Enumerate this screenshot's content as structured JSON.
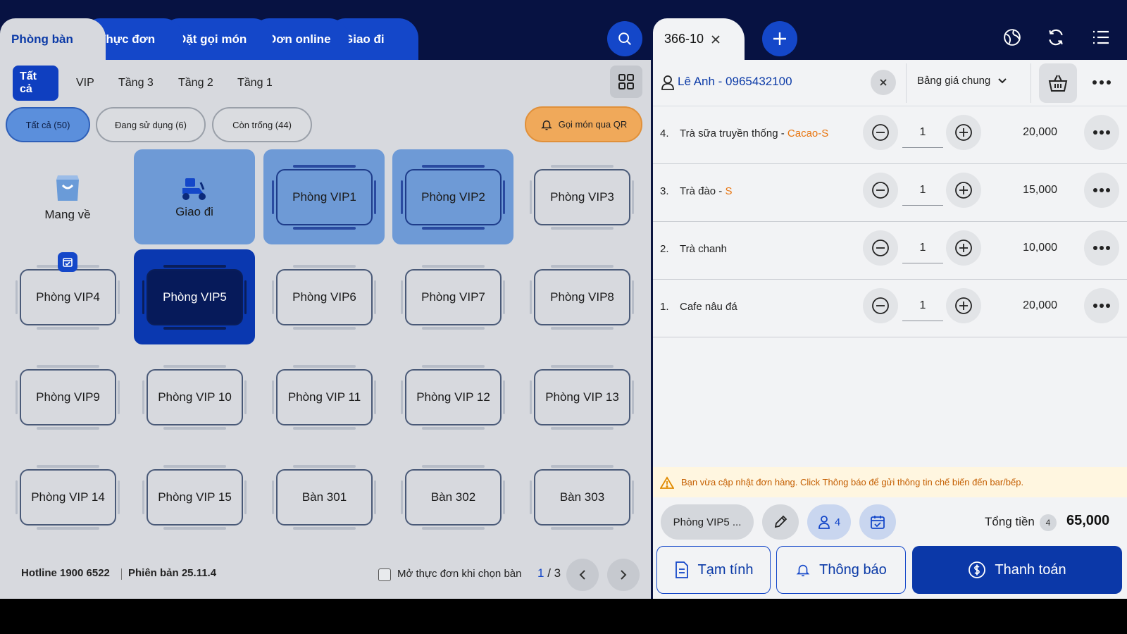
{
  "top_tabs": [
    {
      "label": "Phòng bàn"
    },
    {
      "label": "Thực đơn"
    },
    {
      "label": "Đặt gọi món"
    },
    {
      "label": "Đơn online"
    },
    {
      "label": "Giao đi"
    }
  ],
  "order_tab": {
    "label": "366-10"
  },
  "floors": [
    "Tất cả",
    "VIP",
    "Tầng 3",
    "Tầng 2",
    "Tầng 1"
  ],
  "filters": [
    "Tất cả (50)",
    "Đang sử dụng (6)",
    "Còn trống (44)"
  ],
  "qr_button": "Gọi món qua QR",
  "special": {
    "takeaway": "Mang về",
    "delivery": "Giao đi"
  },
  "tables": [
    "Phòng VIP1",
    "Phòng VIP2",
    "Phòng VIP3",
    "Phòng VIP4",
    "Phòng VIP5",
    "Phòng VIP6",
    "Phòng VIP7",
    "Phòng VIP8",
    "Phòng VIP9",
    "Phòng VIP 10",
    "Phòng VIP 11",
    "Phòng VIP 12",
    "Phòng VIP 13",
    "Phòng VIP 14",
    "Phòng VIP 15",
    "Bàn 301",
    "Bàn 302",
    "Bàn 303"
  ],
  "footer": {
    "hotline": "Hotline 1900 6522",
    "version": "Phiên bản 25.11.4",
    "open_menu_label": "Mở thực đơn khi chọn bàn",
    "page_current": "1",
    "page_sep": "/",
    "page_total": "3"
  },
  "customer": {
    "name": "Lê Anh - 0965432100",
    "price_list": "Bảng giá chung"
  },
  "items": [
    {
      "num": "4.",
      "name": "Trà sữa truyền thống - ",
      "variant": "Cacao-S",
      "qty": "1",
      "amount": "20,000"
    },
    {
      "num": "3.",
      "name": "Trà đào - ",
      "variant": "S",
      "qty": "1",
      "amount": "15,000"
    },
    {
      "num": "2.",
      "name": "Trà chanh",
      "variant": "",
      "qty": "1",
      "amount": "10,000"
    },
    {
      "num": "1.",
      "name": "Cafe nâu đá",
      "variant": "",
      "qty": "1",
      "amount": "20,000"
    }
  ],
  "warning": "Bạn vừa cập nhật đơn hàng. Click Thông báo để gửi thông tin chế biến đến bar/bếp.",
  "order_footer": {
    "table": "Phòng VIP5 ...",
    "guests": "4",
    "total_label": "Tổng tiền",
    "total_count": "4",
    "total_value": "65,000"
  },
  "actions": {
    "print": "Tạm tính",
    "notify": "Thông báo",
    "pay": "Thanh toán"
  },
  "colors": {
    "primary": "#0b38a8",
    "navy": "#071242",
    "warning": "#c45e00",
    "variant": "#e8740e"
  }
}
